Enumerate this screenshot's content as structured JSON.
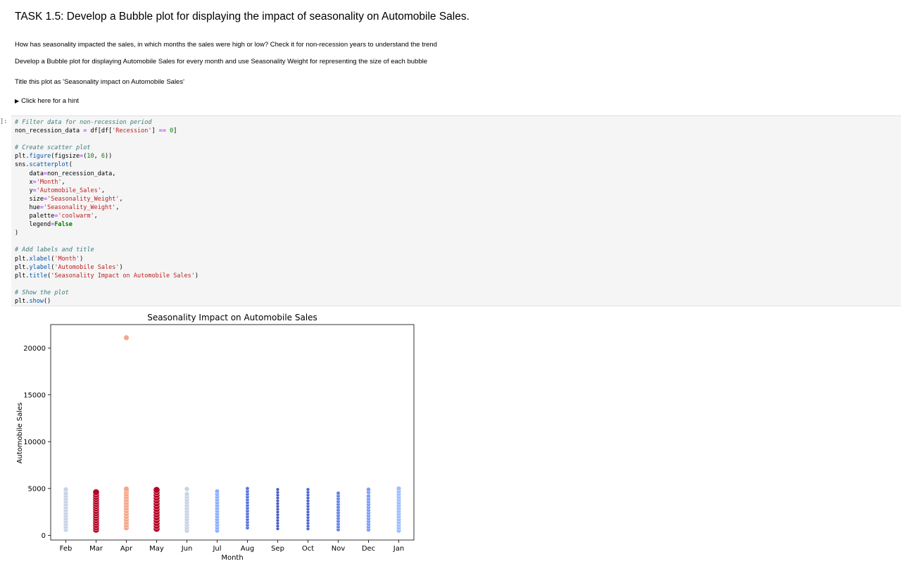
{
  "task_heading": "TASK 1.5: Develop a Bubble plot for displaying the impact of seasonality on Automobile Sales.",
  "question": "How has seasonality impacted the sales, in which months the sales were high or low? Check it for non-recession years to understand the trend",
  "instruction": "Develop a Bubble plot for displaying Automobile Sales for every month and use Seasonality Weight for representing the size of each bubble",
  "title_instruction": "Title this plot as 'Seasonality impact on Automobile Sales'",
  "hint_label": "Click here for a hint",
  "cell_prompt": "]:",
  "code_lines": [
    [
      [
        "c-com",
        "# Filter data for non-recession period"
      ]
    ],
    [
      [
        "",
        "non_recession_data "
      ],
      [
        "c-op",
        "="
      ],
      [
        "",
        " df[df["
      ],
      [
        "c-str",
        "'Recession'"
      ],
      [
        "",
        "] "
      ],
      [
        "c-op",
        "=="
      ],
      [
        "",
        " "
      ],
      [
        "c-num",
        "0"
      ],
      [
        "",
        "]"
      ]
    ],
    [
      [
        "",
        ""
      ]
    ],
    [
      [
        "c-com",
        "# Create scatter plot"
      ]
    ],
    [
      [
        "",
        "plt."
      ],
      [
        "c-fn",
        "figure"
      ],
      [
        "",
        "(figsize"
      ],
      [
        "c-op",
        "="
      ],
      [
        "",
        "("
      ],
      [
        "c-num",
        "10"
      ],
      [
        "",
        ", "
      ],
      [
        "c-num",
        "6"
      ],
      [
        "",
        "))"
      ]
    ],
    [
      [
        "",
        "sns."
      ],
      [
        "c-fn",
        "scatterplot"
      ],
      [
        "",
        "("
      ]
    ],
    [
      [
        "",
        "    data"
      ],
      [
        "c-op",
        "="
      ],
      [
        "",
        "non_recession_data,"
      ]
    ],
    [
      [
        "",
        "    x"
      ],
      [
        "c-op",
        "="
      ],
      [
        "c-str",
        "'Month'"
      ],
      [
        "",
        ","
      ]
    ],
    [
      [
        "",
        "    y"
      ],
      [
        "c-op",
        "="
      ],
      [
        "c-str",
        "'Automobile_Sales'"
      ],
      [
        "",
        ","
      ]
    ],
    [
      [
        "",
        "    size"
      ],
      [
        "c-op",
        "="
      ],
      [
        "c-str",
        "'Seasonality_Weight'"
      ],
      [
        "",
        ","
      ]
    ],
    [
      [
        "",
        "    hue"
      ],
      [
        "c-op",
        "="
      ],
      [
        "c-str",
        "'Seasonality_Weight'"
      ],
      [
        "",
        ","
      ]
    ],
    [
      [
        "",
        "    palette"
      ],
      [
        "c-op",
        "="
      ],
      [
        "c-str",
        "'coolwarm'"
      ],
      [
        "",
        ","
      ]
    ],
    [
      [
        "",
        "    legend"
      ],
      [
        "c-op",
        "="
      ],
      [
        "c-kw",
        "False"
      ]
    ],
    [
      [
        "",
        ")"
      ]
    ],
    [
      [
        "",
        ""
      ]
    ],
    [
      [
        "c-com",
        "# Add labels and title"
      ]
    ],
    [
      [
        "",
        "plt."
      ],
      [
        "c-fn",
        "xlabel"
      ],
      [
        "",
        "("
      ],
      [
        "c-str",
        "'Month'"
      ],
      [
        "",
        ")"
      ]
    ],
    [
      [
        "",
        "plt."
      ],
      [
        "c-fn",
        "ylabel"
      ],
      [
        "",
        "("
      ],
      [
        "c-str",
        "'Automobile Sales'"
      ],
      [
        "",
        ")"
      ]
    ],
    [
      [
        "",
        "plt."
      ],
      [
        "c-fn",
        "title"
      ],
      [
        "",
        "("
      ],
      [
        "c-str",
        "'Seasonality Impact on Automobile Sales'"
      ],
      [
        "",
        ")"
      ]
    ],
    [
      [
        "",
        ""
      ]
    ],
    [
      [
        "c-com",
        "# Show the plot"
      ]
    ],
    [
      [
        "",
        "plt."
      ],
      [
        "c-fn",
        "show"
      ],
      [
        "",
        "()"
      ]
    ]
  ],
  "chart_data": {
    "type": "scatter",
    "title": "Seasonality Impact on Automobile Sales",
    "xlabel": "Month",
    "ylabel": "Automobile Sales",
    "categories": [
      "Feb",
      "Mar",
      "Apr",
      "May",
      "Jun",
      "Jul",
      "Aug",
      "Sep",
      "Oct",
      "Nov",
      "Dec",
      "Jan"
    ],
    "ylim": [
      -500,
      22500
    ],
    "yticks": [
      0,
      5000,
      10000,
      15000,
      20000
    ],
    "grid": false,
    "legend": "none",
    "series": [
      {
        "month": "Feb",
        "color": "#c9d3e6",
        "values": [
          600,
          900,
          1200,
          1500,
          1800,
          2100,
          2400,
          2700,
          3000,
          3300,
          3600,
          3900,
          4200,
          4500,
          4900
        ]
      },
      {
        "month": "Mar",
        "color": "#b40426",
        "values": [
          600,
          850,
          1100,
          1350,
          1600,
          1850,
          2100,
          2350,
          2600,
          2850,
          3100,
          3350,
          3600,
          3850,
          4100,
          4350,
          4600
        ]
      },
      {
        "month": "Apr",
        "color": "#f3a889",
        "values": [
          800,
          1100,
          1400,
          1700,
          2000,
          2300,
          2600,
          2900,
          3200,
          3500,
          3800,
          4100,
          4400,
          4700,
          4950,
          21100
        ]
      },
      {
        "month": "May",
        "color": "#b40426",
        "values": [
          700,
          1000,
          1300,
          1600,
          1900,
          2200,
          2500,
          2800,
          3100,
          3400,
          3700,
          4000,
          4300,
          4600,
          4850
        ]
      },
      {
        "month": "Jun",
        "color": "#c9d3e6",
        "values": [
          500,
          800,
          1100,
          1400,
          1700,
          2000,
          2300,
          2600,
          2900,
          3200,
          3500,
          3800,
          4100,
          4400,
          4950
        ]
      },
      {
        "month": "Jul",
        "color": "#8db0fe",
        "values": [
          500,
          800,
          1100,
          1400,
          1700,
          2000,
          2300,
          2600,
          2900,
          3200,
          3500,
          3800,
          4100,
          4400,
          4700
        ]
      },
      {
        "month": "Aug",
        "color": "#5673e0",
        "values": [
          800,
          1100,
          1400,
          1700,
          2000,
          2300,
          2600,
          2900,
          3200,
          3500,
          3800,
          4100,
          4400,
          4700,
          5000
        ]
      },
      {
        "month": "Sep",
        "color": "#4257c9",
        "values": [
          700,
          1000,
          1300,
          1600,
          1900,
          2200,
          2500,
          2800,
          3100,
          3400,
          3700,
          4000,
          4300,
          4600,
          4900
        ]
      },
      {
        "month": "Oct",
        "color": "#4b64d5",
        "values": [
          700,
          1000,
          1300,
          1600,
          1900,
          2200,
          2500,
          2800,
          3100,
          3400,
          3700,
          4000,
          4300,
          4600,
          4900
        ]
      },
      {
        "month": "Nov",
        "color": "#6282ea",
        "values": [
          600,
          900,
          1200,
          1500,
          1800,
          2100,
          2400,
          2700,
          3000,
          3300,
          3600,
          3900,
          4200,
          4500
        ]
      },
      {
        "month": "Dec",
        "color": "#7b9ff9",
        "values": [
          600,
          900,
          1200,
          1500,
          1800,
          2100,
          2400,
          2700,
          3000,
          3300,
          3600,
          3900,
          4200,
          4600,
          4900
        ]
      },
      {
        "month": "Jan",
        "color": "#9ebeff",
        "values": [
          500,
          800,
          1100,
          1400,
          1700,
          2000,
          2300,
          2600,
          2900,
          3200,
          3500,
          3800,
          4100,
          4400,
          4700,
          5000
        ]
      }
    ]
  }
}
